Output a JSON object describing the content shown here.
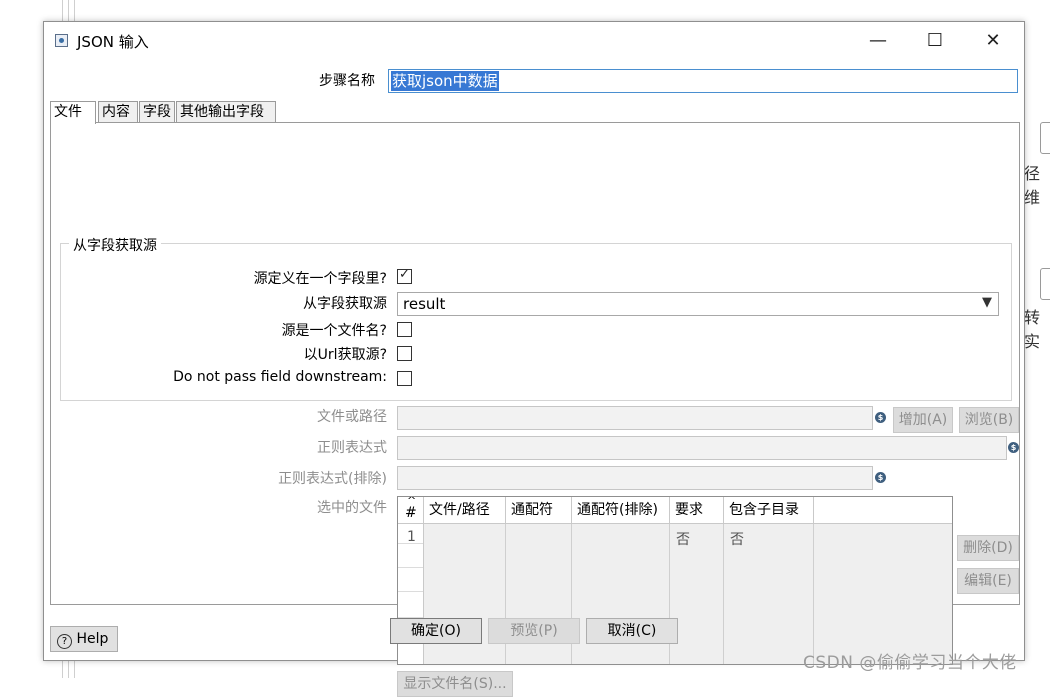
{
  "dialog": {
    "title": "JSON 输入",
    "window_controls": {
      "minimize": "—",
      "maximize": "☐",
      "close": "✕"
    },
    "step_name_label": "步骤名称",
    "step_name_value": "获取json中数据"
  },
  "tabs": [
    {
      "label": "文件",
      "active": true
    },
    {
      "label": "内容",
      "active": false
    },
    {
      "label": "字段",
      "active": false
    },
    {
      "label": "其他输出字段",
      "active": false
    }
  ],
  "source_group": {
    "title": "从字段获取源",
    "source_in_field_label": "源定义在一个字段里?",
    "source_in_field_checked": true,
    "source_field_label": "从字段获取源",
    "source_field_value": "result",
    "source_is_filename_label": "源是一个文件名?",
    "source_is_filename_checked": false,
    "read_url_label": "以Url获取源?",
    "read_url_checked": false,
    "do_not_pass_label": "Do not pass field downstream:",
    "do_not_pass_checked": false
  },
  "file_section": {
    "file_or_dir_label": "文件或路径",
    "add_button": "增加(A)",
    "browse_button": "浏览(B)",
    "regex_label": "正则表达式",
    "regex_exclude_label": "正则表达式(排除)",
    "selected_files_label": "选中的文件",
    "delete_button": "删除(D)",
    "edit_button": "编辑(E)",
    "show_filenames_button": "显示文件名(S)...",
    "var_icon": "$"
  },
  "files_table": {
    "sort_indicator": "^",
    "columns": [
      "#",
      "文件/路径",
      "通配符",
      "通配符(排除)",
      "要求",
      "包含子目录"
    ],
    "rows": [
      {
        "num": "1",
        "path": "",
        "wildcard": "",
        "exclude": "",
        "required": "否",
        "subdirs": "否"
      }
    ]
  },
  "footer": {
    "help_button": "Help",
    "ok_button": "确定(O)",
    "preview_button": "预览(P)",
    "cancel_button": "取消(C)"
  },
  "background": {
    "right_text_1": "径维",
    "right_text_2": "转实",
    "watermark": "CSDN @偷偷学习当个大佬"
  },
  "colors": {
    "selection": "#3778d4",
    "focus_border": "#4a8fd0",
    "disabled_text": "#8e8e8e"
  }
}
